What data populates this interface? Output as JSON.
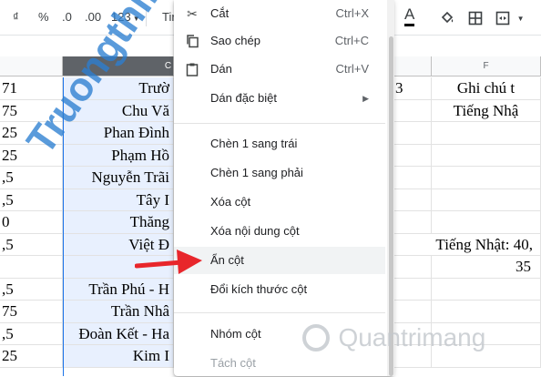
{
  "toolbar": {
    "currency": "₫",
    "percent": "%",
    "decimal_less": ".0",
    "decimal_more": ".00",
    "format_123": "123",
    "font_partial": "Tir"
  },
  "columns": {
    "C": "C",
    "F": "F"
  },
  "rows": [
    {
      "a": "71",
      "c": "Trườ",
      "e": "3",
      "f": "Ghi chú t"
    },
    {
      "a": "75",
      "c": "Chu Vă",
      "e": "",
      "f": "Tiếng Nhậ"
    },
    {
      "a": "25",
      "c": "Phan Đình",
      "e": "",
      "f": ""
    },
    {
      "a": "25",
      "c": "Phạm Hồ",
      "e": "",
      "f": ""
    },
    {
      "a": ",5",
      "c": "Nguyễn Trãi",
      "e": "",
      "f": ""
    },
    {
      "a": ",5",
      "c": "Tây I",
      "e": "",
      "f": ""
    },
    {
      "a": "0",
      "c": "Thăng",
      "e": "",
      "f": ""
    },
    {
      "a": ",5",
      "c": "Việt Đ",
      "e": "Tiếng Nhật: 40,",
      "f": ""
    },
    {
      "a": "",
      "c": "",
      "e": "",
      "f": "35"
    },
    {
      "a": ",5",
      "c": "Trần Phú - H",
      "e": "",
      "f": ""
    },
    {
      "a": "75",
      "c": "Trần Nhâ",
      "e": "",
      "f": ""
    },
    {
      "a": ",5",
      "c": "Đoàn Kết - Ha",
      "e": "",
      "f": ""
    },
    {
      "a": "25",
      "c": "Kim I",
      "e": "",
      "f": ""
    }
  ],
  "watermark": "Truongthi.top",
  "brand_watermark": "Quantrimang",
  "menu": {
    "cut": {
      "label": "Cắt",
      "shortcut": "Ctrl+X"
    },
    "copy": {
      "label": "Sao chép",
      "shortcut": "Ctrl+C"
    },
    "paste": {
      "label": "Dán",
      "shortcut": "Ctrl+V"
    },
    "paste_special": {
      "label": "Dán đặc biệt"
    },
    "insert_left": {
      "label": "Chèn 1 sang trái"
    },
    "insert_right": {
      "label": "Chèn 1 sang phải"
    },
    "delete_column": {
      "label": "Xóa cột"
    },
    "clear_column": {
      "label": "Xóa nội dung cột"
    },
    "hide_column": {
      "label": "Ẩn cột"
    },
    "resize_column": {
      "label": "Đổi kích thước cột"
    },
    "group_column": {
      "label": "Nhóm cột"
    },
    "ungroup_column": {
      "label": "Tách cột"
    }
  },
  "colors": {
    "accent_arrow": "#e8262b",
    "selected_col": "#e8f0fe",
    "watermark": "#2c7fd1"
  }
}
